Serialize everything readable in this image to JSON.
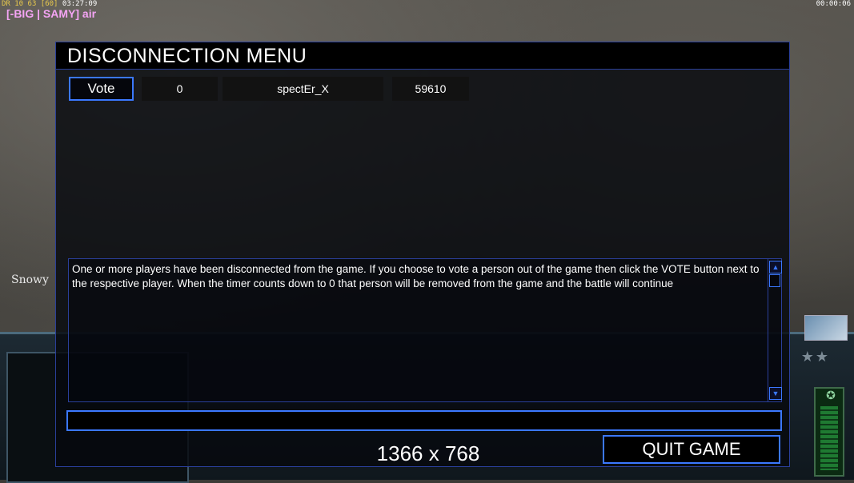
{
  "hud": {
    "stats_prefix": "DR",
    "stats_a": "10",
    "stats_b": "63",
    "stats_c": "[60]",
    "clock": "03:27:09",
    "player_tag": "[-BIG | SAMY] air",
    "elapsed": "00:00:06",
    "map_label": "Snowy"
  },
  "menu": {
    "title": "DISCONNECTION MENU",
    "players": [
      {
        "vote_label": "Vote",
        "timer": "0",
        "name": "spectEr_X",
        "ping": "59610"
      }
    ],
    "message": "One or more players have been disconnected from the game. If you choose to vote a person out of the game then click the VOTE button next to the respective player. When the timer counts down to 0 that person will be removed from the game and the battle will continue",
    "chat_value": "",
    "resolution_label": "1366 x 768",
    "quit_label": "QUIT GAME"
  },
  "colors": {
    "accent_border": "#3b78ff",
    "panel_border": "#2a3f9a",
    "player_tag": "#f4a4f4",
    "stats_gold": "#e9c94c"
  },
  "icons": [
    "scroll-up-icon",
    "scroll-down-icon",
    "satellite-icon",
    "rank-star-icon"
  ]
}
